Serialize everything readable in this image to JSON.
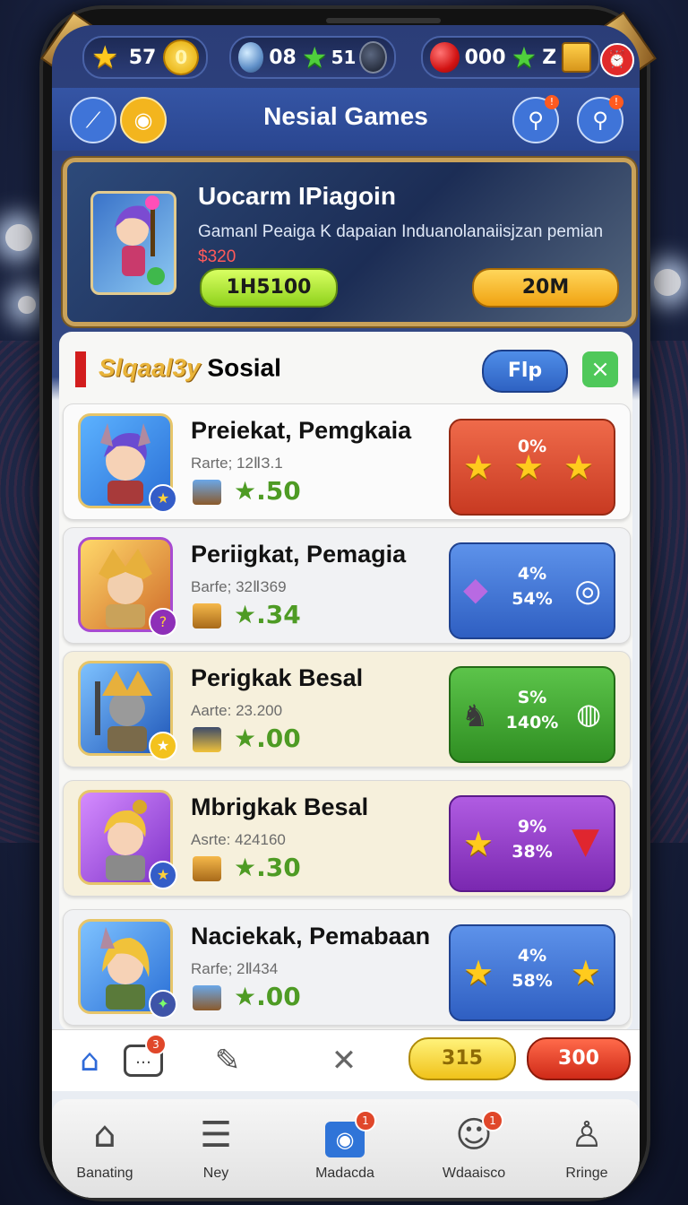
{
  "status": {
    "stars": "57",
    "gems": "08",
    "green_stars": "51",
    "tickets": "000",
    "z_label": "Z"
  },
  "header": {
    "title": "Nesial Games"
  },
  "banner": {
    "title": "Uocarm IPiagoin",
    "desc": "Gamanl  Peaiga K dapaian Induanolanaiisjzan pemian",
    "price": "$320",
    "btn1": "1H5100",
    "btn2": "20M"
  },
  "panel": {
    "title_gold": "Slqaal3y",
    "title": "Sosial",
    "flp_label": "Flp",
    "close_label": "×"
  },
  "rows": [
    {
      "title": "Preiekat, Pemgkaia",
      "sub": "Rarte; 12ⅡЗ.1",
      "value": "★.50",
      "pct_a": "0%",
      "pct_b": "",
      "btn_color": "red"
    },
    {
      "title": "Periigkat, Pemagia",
      "sub": "Barfe; 32ⅡЗ69",
      "value": "★.34",
      "pct_a": "4%",
      "pct_b": "54%",
      "btn_color": "blue"
    },
    {
      "title": "Perigkak Besal",
      "sub": "Aarte: 23.200",
      "value": "★.00",
      "pct_a": "S%",
      "pct_b": "140%",
      "btn_color": "green"
    },
    {
      "title": "Mbrigkak Besal",
      "sub": "Asrte: 424160",
      "value": "★.30",
      "pct_a": "9%",
      "pct_b": "38%",
      "btn_color": "purple"
    },
    {
      "title": "Naciekak, Pemabaan",
      "sub": "Rarfe;  2Ⅱ434",
      "value": "★.00",
      "pct_a": "4%",
      "pct_b": "58%",
      "btn_color": "blue"
    }
  ],
  "actionbar": {
    "chat_badge": "3",
    "pill_yellow": "315",
    "pill_red": "300"
  },
  "tabs": [
    {
      "label": "Banating",
      "icon": "house-icon"
    },
    {
      "label": "Ney",
      "icon": "document-icon"
    },
    {
      "label": "Madacda",
      "icon": "camera-icon",
      "badge": "1"
    },
    {
      "label": "Wdaaisco",
      "icon": "chat-person-icon",
      "badge": "1"
    },
    {
      "label": "Rringe",
      "icon": "profile-icon"
    }
  ],
  "colors": {
    "red": "#d9492f",
    "blue": "#3a6fcf",
    "green": "#45a83a",
    "purple": "#8e3fc0",
    "accent_gold": "#c9a25a"
  }
}
